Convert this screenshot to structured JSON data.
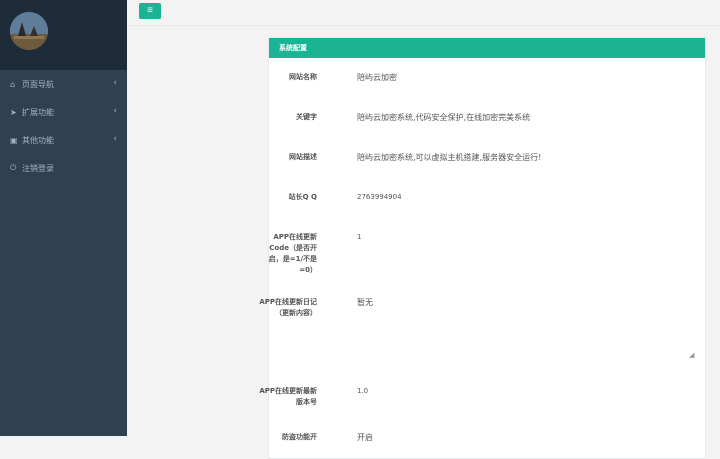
{
  "sidebar": {
    "items": [
      {
        "icon": "home-icon",
        "glyph": "⌂",
        "label": "页面导航",
        "has_arrow": true
      },
      {
        "icon": "paper-plane-icon",
        "glyph": "➤",
        "label": "扩展功能",
        "has_arrow": true
      },
      {
        "icon": "briefcase-icon",
        "glyph": "▣",
        "label": "其他功能",
        "has_arrow": true
      },
      {
        "icon": "power-icon",
        "glyph": "⏻",
        "label": "注销登录",
        "has_arrow": false
      }
    ],
    "arrow_glyph": "‹"
  },
  "toolbar": {
    "menu_glyph": "≡"
  },
  "panel": {
    "title": "系统配置",
    "fields": [
      {
        "label": "网站名称",
        "value": "陪屿云加密"
      },
      {
        "label": "关键字",
        "value": "陪屿云加密系统,代码安全保护,在线加密完美系统"
      },
      {
        "label": "网站描述",
        "value": "陪屿云加密系统,可以虚拟主机搭建,服务器安全运行!"
      },
      {
        "label": "站长Q Q",
        "value": "2763994904"
      },
      {
        "label": "APP在线更新Code（是否开启，是=1/不是=0）",
        "value": "1"
      },
      {
        "label": "APP在线更新日记（更新内容）",
        "value": "暂无"
      },
      {
        "label": "APP在线更新最新版本号",
        "value": "1.0"
      },
      {
        "label": "防盗功能开",
        "value": "开启"
      }
    ]
  },
  "colors": {
    "accent": "#1ab394",
    "sidebar": "#2f4050"
  }
}
